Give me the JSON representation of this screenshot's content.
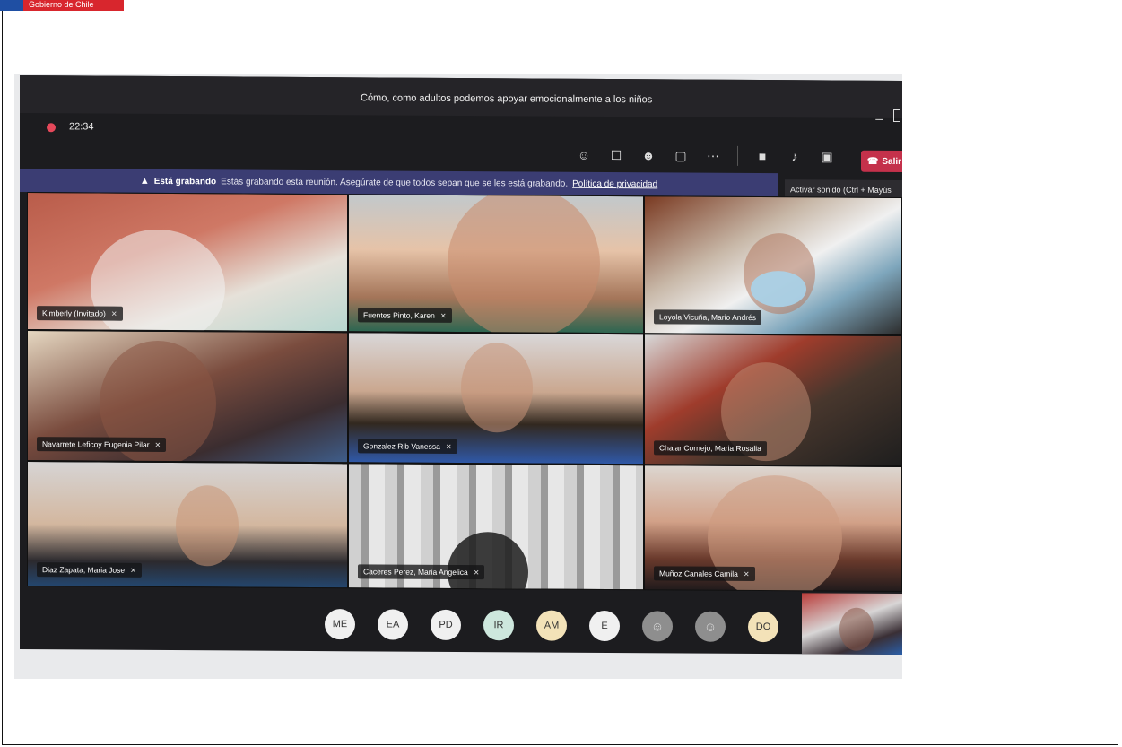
{
  "brand_strip": {
    "text": "Gobierno de Chile"
  },
  "meeting": {
    "title": "Cómo, como adultos podemos apoyar emocionalmente a los niños",
    "timer": "22:34"
  },
  "toolbar": {
    "icons": [
      "participants-icon",
      "chat-icon",
      "reactions-icon",
      "rooms-icon",
      "more-icon",
      "camera-icon",
      "mic-muted-icon",
      "share-icon"
    ],
    "leave_label": "Salir",
    "tooltip": "Activar sonido (Ctrl + Mayús"
  },
  "recording_banner": {
    "bold": "Está grabando",
    "text": "Estás grabando esta reunión. Asegúrate de que todos sepan que se les está grabando.",
    "link": "Política de privacidad"
  },
  "participants": [
    {
      "name": "Kimberly (Invitado)",
      "muted": true
    },
    {
      "name": "Fuentes Pinto, Karen",
      "muted": true
    },
    {
      "name": "Loyola Vicuña, Mario Andrés",
      "muted": false
    },
    {
      "name": "Navarrete Leficoy Eugenia Pilar",
      "muted": true
    },
    {
      "name": "Gonzalez Rib Vanessa",
      "muted": true
    },
    {
      "name": "Chalar Cornejo, Maria Rosalia",
      "muted": false
    },
    {
      "name": "Diaz Zapata, Maria Jose",
      "muted": true
    },
    {
      "name": "Caceres Perez, Maria Angelica",
      "muted": true
    },
    {
      "name": "Muñoz Canales Camila",
      "muted": true
    }
  ],
  "avatars": [
    "ME",
    "EA",
    "PD",
    "IR",
    "AM",
    "E",
    "",
    "",
    "DO"
  ]
}
